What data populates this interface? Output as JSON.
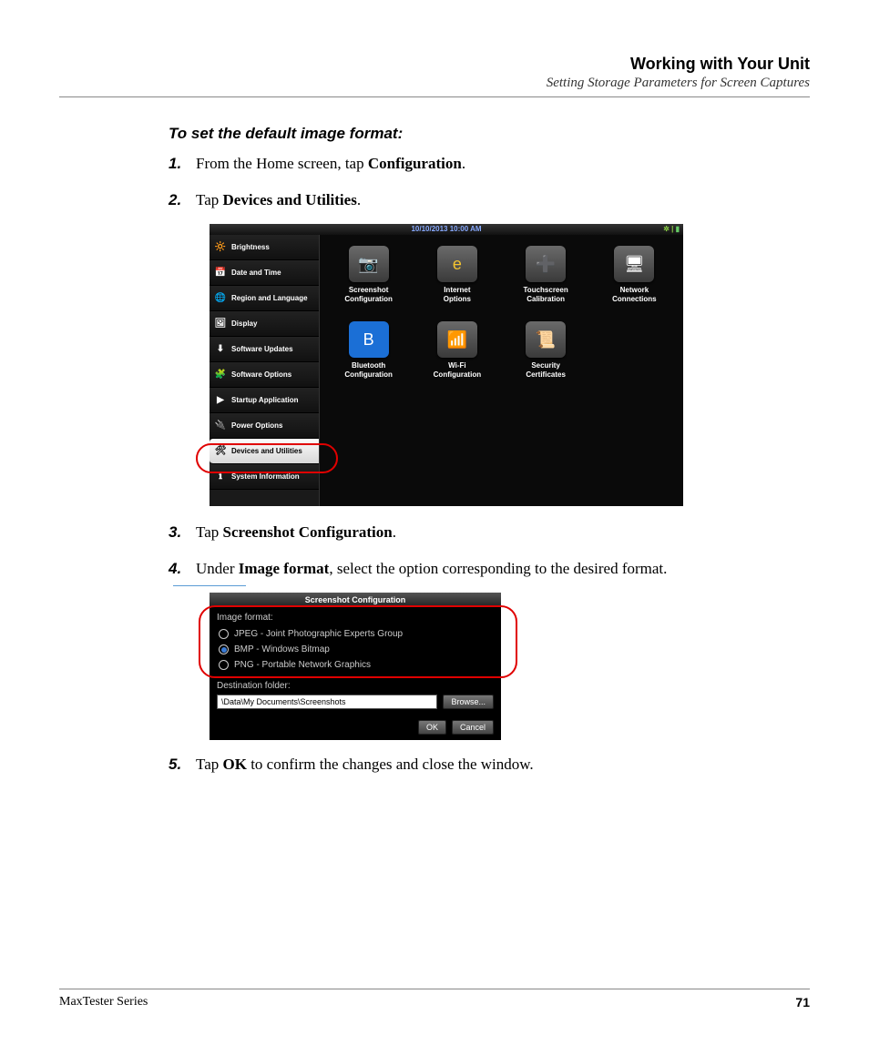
{
  "header": {
    "title": "Working with Your Unit",
    "subtitle": "Setting Storage Parameters for Screen Captures"
  },
  "heading": "To set the default image format:",
  "steps": {
    "s1": {
      "num": "1.",
      "pre": "From the Home screen, tap ",
      "bold": "Configuration",
      "post": "."
    },
    "s2": {
      "num": "2.",
      "pre": "Tap ",
      "bold": "Devices and Utilities",
      "post": "."
    },
    "s3": {
      "num": "3.",
      "pre": "Tap ",
      "bold": "Screenshot Configuration",
      "post": "."
    },
    "s4": {
      "num": "4.",
      "pre": "Under ",
      "bold": "Image format",
      "post": ", select the option corresponding to the desired format."
    },
    "s5": {
      "num": "5.",
      "pre": "Tap ",
      "bold": "OK",
      "post": " to confirm the changes and close the window."
    }
  },
  "screenshot1": {
    "datetime": "10/10/2013 10:00 AM",
    "sidebar": [
      {
        "icon": "🔆",
        "label": "Brightness",
        "iconName": "brightness-icon"
      },
      {
        "icon": "📅",
        "label": "Date and Time",
        "iconName": "calendar-icon"
      },
      {
        "icon": "🌐",
        "label": "Region and Language",
        "iconName": "globe-icon"
      },
      {
        "icon": "🖼",
        "label": "Display",
        "iconName": "display-icon"
      },
      {
        "icon": "⬇",
        "label": "Software Updates",
        "iconName": "download-icon"
      },
      {
        "icon": "🧩",
        "label": "Software Options",
        "iconName": "puzzle-icon"
      },
      {
        "icon": "▶",
        "label": "Startup Application",
        "iconName": "startup-icon"
      },
      {
        "icon": "🔌",
        "label": "Power Options",
        "iconName": "power-icon"
      },
      {
        "icon": "🛠",
        "label": "Devices and Utilities",
        "iconName": "tools-icon",
        "selected": true
      },
      {
        "icon": "ℹ",
        "label": "System Information",
        "iconName": "info-icon"
      }
    ],
    "tiles": [
      {
        "icon": "📷",
        "label": "Screenshot Configuration",
        "iconName": "camera-icon"
      },
      {
        "icon": "e",
        "label": "Internet Options",
        "iconName": "ie-icon",
        "iconColor": "#f4c430"
      },
      {
        "icon": "➕",
        "label": "Touchscreen Calibration",
        "iconName": "calibrate-icon"
      },
      {
        "icon": "🖥",
        "label": "Network Connections",
        "iconName": "network-icon"
      },
      {
        "icon": "B",
        "label": "Bluetooth Configuration",
        "iconName": "bluetooth-icon",
        "iconBg": "#1b6fd6"
      },
      {
        "icon": "📶",
        "label": "Wi-Fi Configuration",
        "iconName": "wifi-icon"
      },
      {
        "icon": "📜",
        "label": "Security Certificates",
        "iconName": "certificate-icon"
      },
      {
        "empty": true
      }
    ]
  },
  "screenshot2": {
    "title": "Screenshot Configuration",
    "imageFormatLabel": "Image format:",
    "options": [
      {
        "label": "JPEG - Joint Photographic Experts Group",
        "checked": false
      },
      {
        "label": "BMP - Windows Bitmap",
        "checked": true
      },
      {
        "label": "PNG - Portable Network Graphics",
        "checked": false
      }
    ],
    "destLabel": "Destination folder:",
    "destPath": "\\Data\\My Documents\\Screenshots",
    "browse": "Browse...",
    "ok": "OK",
    "cancel": "Cancel"
  },
  "footer": {
    "series": "MaxTester Series",
    "page": "71"
  }
}
